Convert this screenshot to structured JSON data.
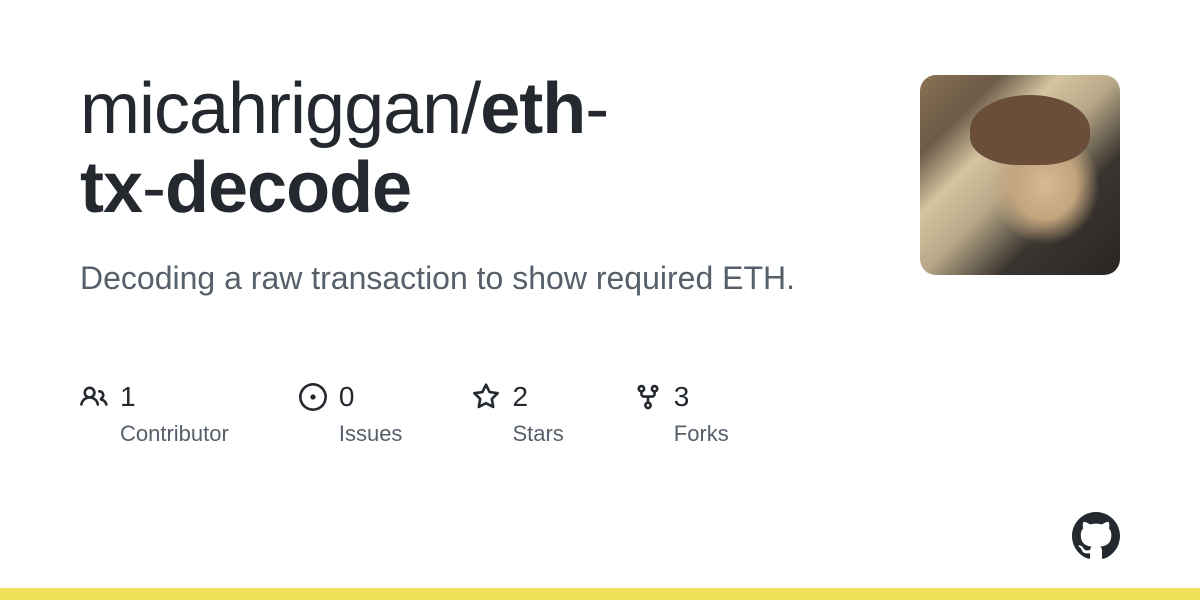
{
  "repo": {
    "owner": "micahriggan",
    "name_parts": [
      "eth",
      "tx",
      "decode"
    ],
    "description": "Decoding a raw transaction to show required ETH."
  },
  "stats": {
    "contributors": {
      "value": "1",
      "label": "Contributor"
    },
    "issues": {
      "value": "0",
      "label": "Issues"
    },
    "stars": {
      "value": "2",
      "label": "Stars"
    },
    "forks": {
      "value": "3",
      "label": "Forks"
    }
  },
  "colors": {
    "language_bar": "#f1e05a"
  }
}
